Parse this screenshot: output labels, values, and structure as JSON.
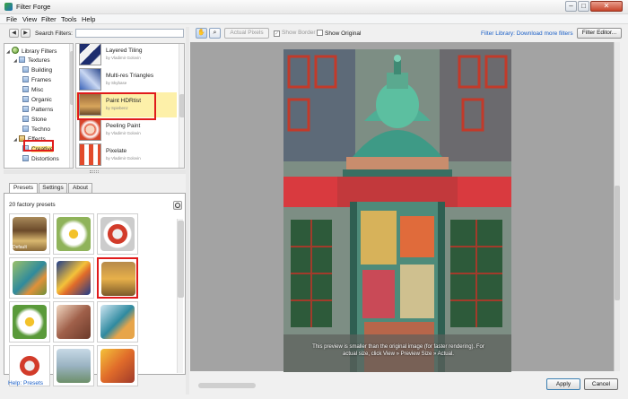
{
  "window": {
    "title": "Filter Forge",
    "min": "–",
    "max": "□",
    "close": "✕"
  },
  "menu": [
    "File",
    "View",
    "Filter",
    "Tools",
    "Help"
  ],
  "search": {
    "label": "Search Filters:",
    "value": "",
    "back": "◀",
    "forward": "▶"
  },
  "tree": [
    {
      "label": "Library Filters",
      "depth": 0,
      "type": "lib",
      "arrow": "◢"
    },
    {
      "label": "Textures",
      "depth": 1,
      "type": "folder",
      "arrow": "◢"
    },
    {
      "label": "Building",
      "depth": 2,
      "type": "folder",
      "arrow": ""
    },
    {
      "label": "Frames",
      "depth": 2,
      "type": "folder",
      "arrow": ""
    },
    {
      "label": "Misc",
      "depth": 2,
      "type": "folder",
      "arrow": ""
    },
    {
      "label": "Organic",
      "depth": 2,
      "type": "folder",
      "arrow": ""
    },
    {
      "label": "Patterns",
      "depth": 2,
      "type": "folder",
      "arrow": ""
    },
    {
      "label": "Stone",
      "depth": 2,
      "type": "folder",
      "arrow": ""
    },
    {
      "label": "Techno",
      "depth": 2,
      "type": "folder",
      "arrow": ""
    },
    {
      "label": "Effects",
      "depth": 1,
      "type": "fx",
      "arrow": "◢"
    },
    {
      "label": "Creative",
      "depth": 2,
      "type": "folder",
      "arrow": "",
      "selected": true
    },
    {
      "label": "Distortions",
      "depth": 2,
      "type": "folder",
      "arrow": ""
    }
  ],
  "filters": [
    {
      "name": "Layered Tiling",
      "author": "by Vladimir Golovin"
    },
    {
      "name": "Multi-res Triangles",
      "author": "by Skybase"
    },
    {
      "name": "Paint HDRtist",
      "author": "by Spiebenz",
      "selected": true
    },
    {
      "name": "Peeling Paint",
      "author": "by Vladimir Golovin"
    },
    {
      "name": "Pixelate",
      "author": "by Vladimir Golovin"
    }
  ],
  "tabs": [
    "Presets",
    "Settings",
    "About"
  ],
  "presets": {
    "count_label": "20 factory presets",
    "default_label": "Default",
    "items": [
      {
        "name": "preset-window",
        "selected": false
      },
      {
        "name": "preset-daisy",
        "selected": false
      },
      {
        "name": "preset-lifebuoy",
        "selected": false
      },
      {
        "name": "preset-kingfisher",
        "selected": false
      },
      {
        "name": "preset-fish",
        "selected": false
      },
      {
        "name": "preset-window-selected",
        "selected": true
      },
      {
        "name": "preset-daisy-2",
        "selected": false
      },
      {
        "name": "preset-portrait",
        "selected": false
      },
      {
        "name": "preset-kingfisher-2",
        "selected": false
      },
      {
        "name": "preset-lifebuoy-2",
        "selected": false
      },
      {
        "name": "preset-landscape",
        "selected": false
      },
      {
        "name": "preset-fish-2",
        "selected": false
      }
    ]
  },
  "help_link": "Help: Presets",
  "toolbar": {
    "actual_pixels": "Actual Pixels",
    "show_border": "Show Border",
    "show_original": "Show Original",
    "library_link": "Filter Library: Download more filters",
    "editor": "Filter Editor..."
  },
  "preview_notice": "This preview is smaller than the original image (for faster rendering). For actual size, click View » Preview Size » Actual.",
  "buttons": {
    "apply": "Apply",
    "cancel": "Cancel"
  },
  "colors": {
    "accent": "#1a5fc7",
    "highlight": "#e01b1b",
    "selection": "#fde98a"
  }
}
